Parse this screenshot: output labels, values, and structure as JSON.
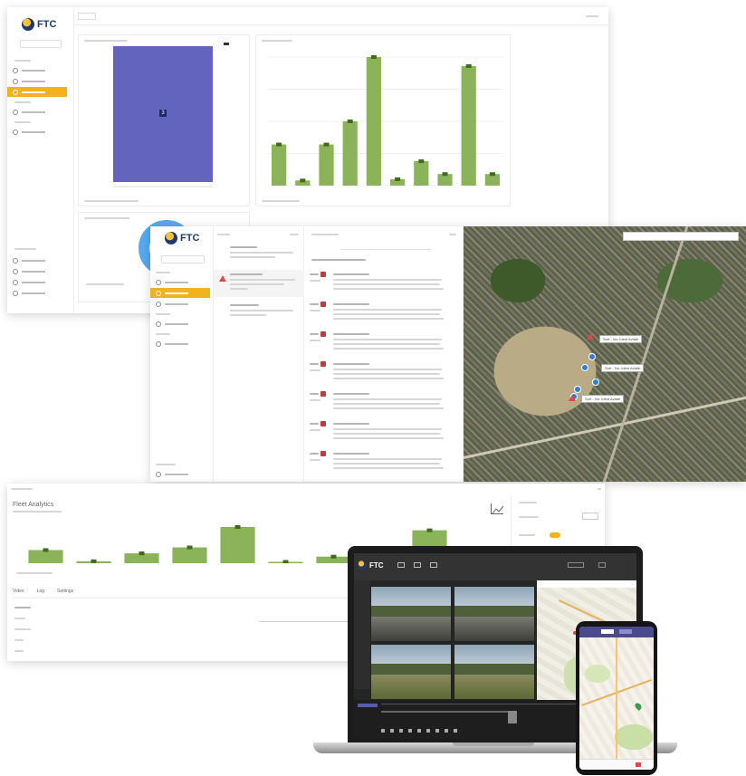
{
  "brand": {
    "name": "FTC",
    "accent": "#f2b21c",
    "bar_color": "#8bb35a",
    "histogram_color": "#6264bd",
    "pin_color": "#2f7fd8",
    "alert_color": "#e04848"
  },
  "dashboard": {
    "histogram": {
      "value": 3,
      "fill_fraction": 1.0
    },
    "bar_chart": {
      "values": [
        3.2,
        0.4,
        3.2,
        5.0,
        10.0,
        0.5,
        1.9,
        0.9,
        9.3,
        0.9
      ]
    },
    "donut": {
      "percent": 100
    }
  },
  "events_map": {
    "tags": [
      "Sort - No: Ident Avtale",
      "Sort - No: Ident Avtale",
      "Sort - No: Ident Avtale"
    ]
  },
  "analytics": {
    "title": "Fleet Analytics",
    "bar_values": [
      2.0,
      0.3,
      1.5,
      2.4,
      5.5,
      0.2,
      1.0,
      0.1,
      5.0,
      0.2
    ],
    "tabs": [
      "Video",
      "Log",
      "Settings"
    ]
  },
  "icons": [
    "globe-logo-icon",
    "camera-icon",
    "chart-icon",
    "alert-icon",
    "map-pin-icon"
  ]
}
